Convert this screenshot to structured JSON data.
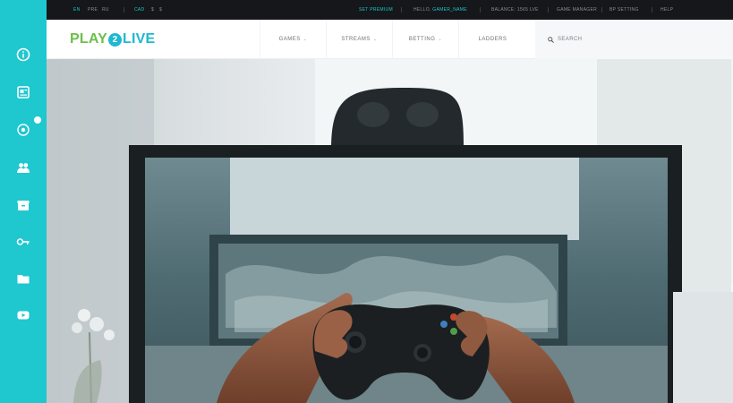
{
  "sidebar": {
    "icons": [
      {
        "name": "info-icon"
      },
      {
        "name": "news-icon"
      },
      {
        "name": "target-icon"
      },
      {
        "name": "community-icon"
      },
      {
        "name": "shop-icon"
      },
      {
        "name": "key-icon"
      },
      {
        "name": "folder-icon"
      },
      {
        "name": "video-icon"
      }
    ]
  },
  "topbar": {
    "left_items": [
      "EN",
      "PRE",
      "RU",
      "CAD",
      "$",
      "$"
    ],
    "links": [
      {
        "label": "SET PREMIUM"
      },
      {
        "label_prefix": "HELLO,",
        "label_user": "GAMER_NAME"
      },
      {
        "label": "BALANCE: 1565 LVE"
      },
      {
        "label": "GAME MANAGER"
      },
      {
        "label": "BP SETTING"
      },
      {
        "label": "HELP"
      }
    ]
  },
  "header": {
    "logo": {
      "part1": "PLAY",
      "part2": "2",
      "part3": "LIVE"
    },
    "nav": [
      {
        "label": "GAMES"
      },
      {
        "label": "STREAMS"
      },
      {
        "label": "BETTING"
      },
      {
        "label": "LADDERS"
      }
    ],
    "search_placeholder": "SEARCH"
  },
  "colors": {
    "accent": "#1fc7cf",
    "logo_green": "#6cc04a",
    "logo_blue": "#1fb8d0",
    "topbar_bg": "#15171a"
  }
}
